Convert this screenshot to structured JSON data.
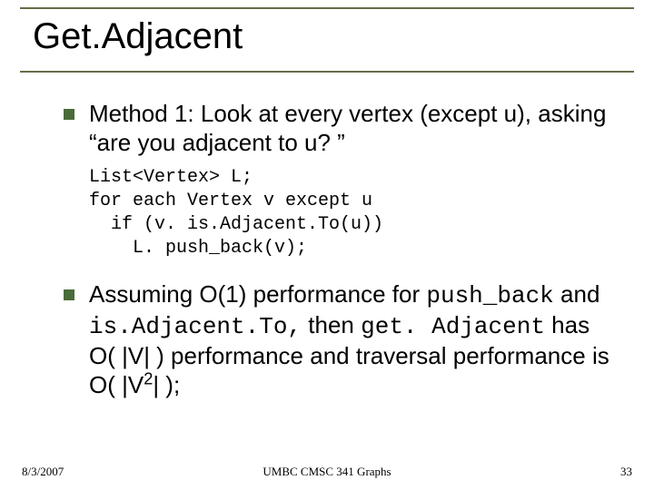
{
  "title": "Get.Adjacent",
  "bullets": [
    {
      "text": "Method 1:  Look at every vertex (except u), asking “are you adjacent to u? ”"
    },
    {
      "text_before": "Assuming O(1) performance for ",
      "code1": "push_back",
      "mid1": " and ",
      "code2": "is.Adjacent.To,",
      "mid2": " then ",
      "code3": "get. Adjacent",
      "tail": " has O( |V| ) performance and traversal performance is O( |V",
      "squared": "2",
      "after_sq": "| );"
    }
  ],
  "code": {
    "l1": "List<Vertex> L;",
    "l2": "for each Vertex v except u",
    "l3": "  if (v. is.Adjacent.To(u))",
    "l4": "    L. push_back(v);"
  },
  "footer": {
    "date": "8/3/2007",
    "center": "UMBC CMSC 341 Graphs",
    "page": "33"
  }
}
